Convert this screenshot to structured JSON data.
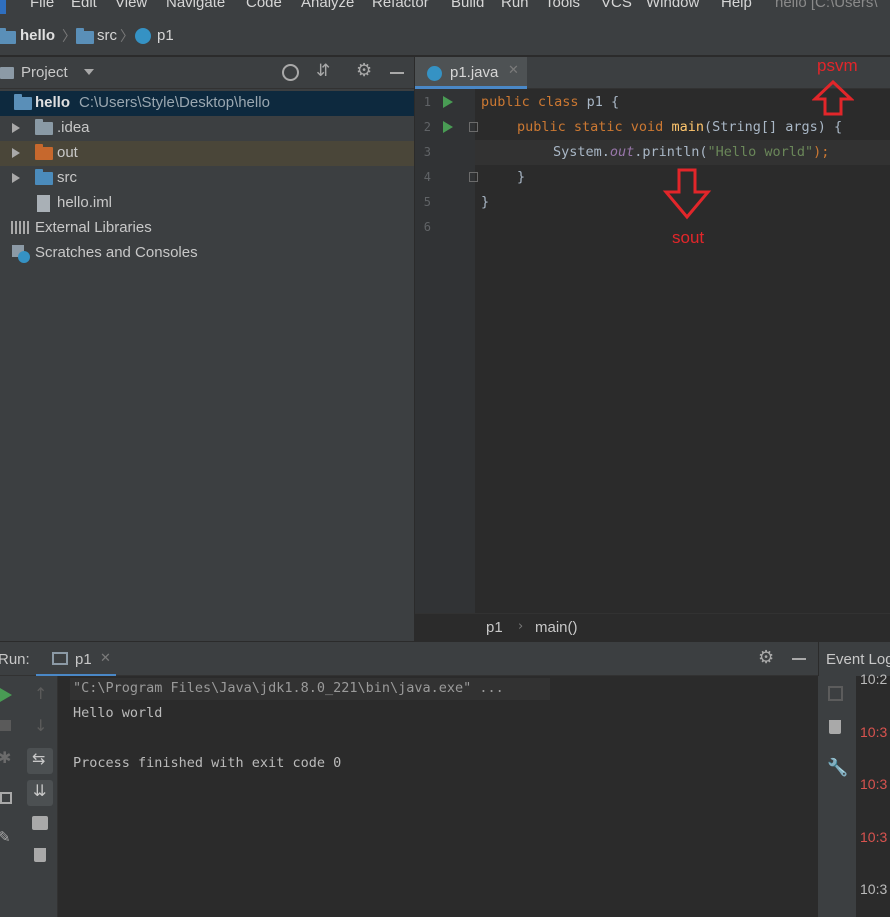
{
  "menu": {
    "items": [
      "File",
      "Edit",
      "View",
      "Navigate",
      "Code",
      "Analyze",
      "Refactor",
      "Build",
      "Run",
      "Tools",
      "VCS",
      "Window",
      "Help"
    ],
    "window_title": "hello [C:\\Users\\"
  },
  "breadcrumb": {
    "project": "hello",
    "folder": "src",
    "file": "p1"
  },
  "project_panel": {
    "title": "Project",
    "root": {
      "name": "hello",
      "path": "C:\\Users\\Style\\Desktop\\hello"
    },
    "items": [
      {
        "name": ".idea"
      },
      {
        "name": "out"
      },
      {
        "name": "src"
      },
      {
        "name": "hello.iml"
      }
    ],
    "external_libraries": "External Libraries",
    "scratches": "Scratches and Consoles"
  },
  "editor": {
    "tab_label": "p1.java",
    "line_numbers": [
      "1",
      "2",
      "3",
      "4",
      "5",
      "6"
    ],
    "code": {
      "l1_kw": "public class ",
      "l1_rest": "p1 {",
      "l2_kw": "public static void ",
      "l2_fn": "main",
      "l2_rest": "(String[] args) {",
      "l3_a": "System.",
      "l3_field": "out",
      "l3_b": ".println(",
      "l3_str": "\"Hello world\"",
      "l3_end": ");",
      "l4": "}",
      "l5": "}"
    },
    "breadcrumb_class": "p1",
    "breadcrumb_method": "main()"
  },
  "annotations": {
    "top": "psvm",
    "bottom": "sout"
  },
  "run_panel": {
    "title": "Run:",
    "tab_label": "p1",
    "console_lines": [
      "\"C:\\Program Files\\Java\\jdk1.8.0_221\\bin\\java.exe\" ...",
      "Hello world",
      "",
      "Process finished with exit code 0"
    ]
  },
  "event_log": {
    "title": "Event Log",
    "times": [
      "10:2",
      "10:3",
      "10:3",
      "10:3",
      "10:3"
    ]
  },
  "colors": {
    "background": "#2b2b2b",
    "panel": "#3c3f41",
    "keyword": "#cc7832",
    "string": "#6a8759",
    "annotation": "#e2262a"
  }
}
